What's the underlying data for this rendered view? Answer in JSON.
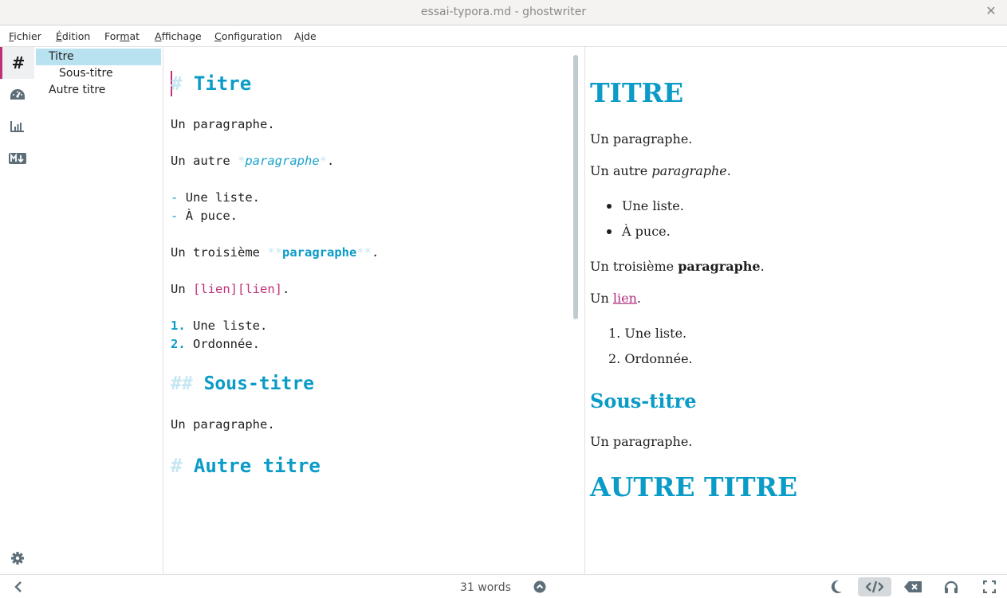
{
  "window": {
    "title": "essai-typora.md - ghostwriter",
    "close_icon": "close-icon"
  },
  "menu": [
    {
      "label": "Fichier",
      "accel": "F"
    },
    {
      "label": "Édition",
      "accel": "É"
    },
    {
      "label": "Format",
      "accel": "m"
    },
    {
      "label": "Affichage",
      "accel": "A"
    },
    {
      "label": "Configuration",
      "accel": "C"
    },
    {
      "label": "Aide",
      "accel": "i"
    }
  ],
  "sidebar": {
    "icons": [
      "outline-hash-icon",
      "statistics-gauge-icon",
      "document-stats-chart-icon",
      "markdown-cheatsheet-icon"
    ],
    "settings_icon": "gear-icon",
    "outline": [
      {
        "label": "Titre",
        "level": 1,
        "selected": true
      },
      {
        "label": "Sous-titre",
        "level": 2,
        "selected": false
      },
      {
        "label": "Autre titre",
        "level": 1,
        "selected": false
      }
    ]
  },
  "editor": {
    "h1_marker": "#",
    "h1": "Titre",
    "p1": "Un paragraphe.",
    "p2_prefix": "Un autre ",
    "p2_mark": "*",
    "p2_em": "paragraphe",
    "p2_suffix": ".",
    "list_marker": "-",
    "ul": [
      "Une liste.",
      "À puce."
    ],
    "p3_prefix": "Un troisième ",
    "p3_mark": "**",
    "p3_strong": "paragraphe",
    "p3_suffix": ".",
    "p4_prefix": "Un ",
    "p4_link": "[lien][lien]",
    "p4_suffix": ".",
    "ol_markers": [
      "1.",
      "2."
    ],
    "ol": [
      "Une liste.",
      "Ordonnée."
    ],
    "h2_marker": "##",
    "h2": "Sous-titre",
    "p5": "Un paragraphe.",
    "h1b_marker": "#",
    "h1b": "Autre titre"
  },
  "preview": {
    "h1": "TITRE",
    "p1": "Un paragraphe.",
    "p2_prefix": "Un autre ",
    "p2_em": "paragraphe",
    "p2_suffix": ".",
    "ul": [
      "Une liste.",
      "À puce."
    ],
    "p3_prefix": "Un troisième ",
    "p3_strong": "paragraphe",
    "p3_suffix": ".",
    "p4_prefix": "Un ",
    "p4_link": "lien",
    "p4_suffix": ".",
    "ol": [
      "1. Une liste.",
      "2. Ordonnée."
    ],
    "h2": "Sous-titre",
    "p5": "Un paragraphe.",
    "h1b": "AUTRE TITRE"
  },
  "statusbar": {
    "word_count": "31 words",
    "icons": [
      "collapse-sidebar-icon",
      "show-options-icon",
      "dark-mode-icon",
      "html-preview-icon",
      "hemingway-mode-icon",
      "distraction-free-icon",
      "fullscreen-icon"
    ],
    "html_preview_active": true
  },
  "colors": {
    "accent": "#0a9bc7",
    "link": "#c0307a",
    "marker": "#c5e6f2",
    "outline_selection": "#b8e2f0"
  }
}
